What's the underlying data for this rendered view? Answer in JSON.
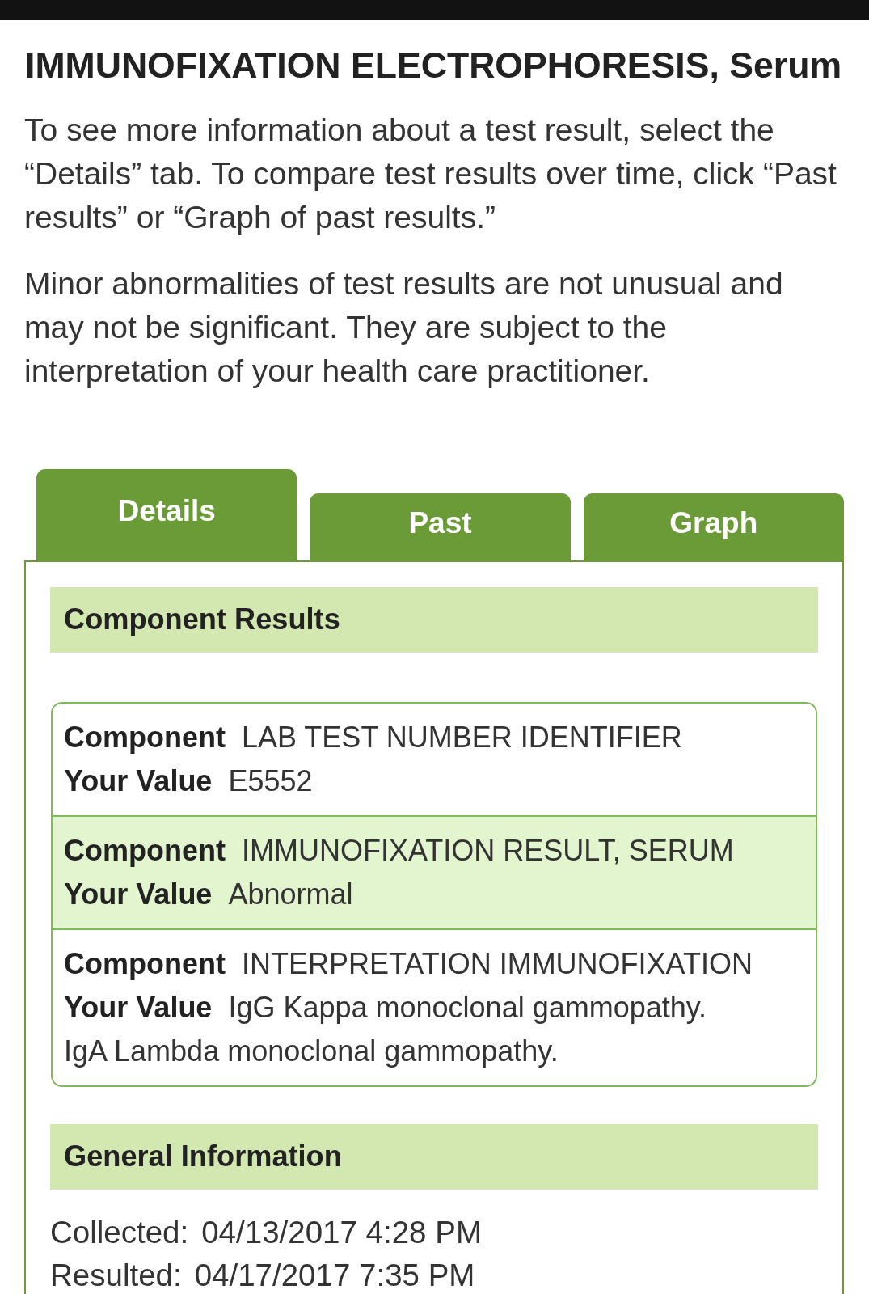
{
  "title": "IMMUNOFIXATION ELECTROPHORESIS, Serum",
  "intro": [
    "To see more information about a test result, select the “Details” tab. To compare test results over time, click “Past results” or “Graph of past results.”",
    "Minor abnormalities of test results are not unusual and may not be significant. They are subject to the interpretation of your health care practitioner."
  ],
  "tabs": [
    {
      "label": "Details",
      "selected": true
    },
    {
      "label": "Past",
      "selected": false
    },
    {
      "label": "Graph",
      "selected": false
    }
  ],
  "sections": [
    {
      "kind": "components",
      "heading": "Component Results",
      "components": [
        {
          "fields": [
            {
              "label": "Component",
              "value": "LAB TEST NUMBER IDENTIFIER"
            },
            {
              "label": "Your Value",
              "value": "E5552"
            }
          ]
        },
        {
          "fields": [
            {
              "label": "Component",
              "value": "IMMUNOFIXATION RESULT, SERUM"
            },
            {
              "label": "Your Value",
              "value": "Abnormal"
            }
          ]
        },
        {
          "fields": [
            {
              "label": "Component",
              "value": "INTERPRETATION IMMUNOFIXATION"
            },
            {
              "label": "Your Value",
              "value": "IgG Kappa monoclonal gammopathy.\nIgA Lambda monoclonal gammopathy."
            }
          ]
        }
      ]
    },
    {
      "kind": "info",
      "heading": "General Information",
      "items": [
        {
          "label": "Collected:",
          "value": "04/13/2017 4:28 PM"
        },
        {
          "label": "Resulted:",
          "value": "04/17/2017 7:35 PM"
        }
      ]
    }
  ]
}
